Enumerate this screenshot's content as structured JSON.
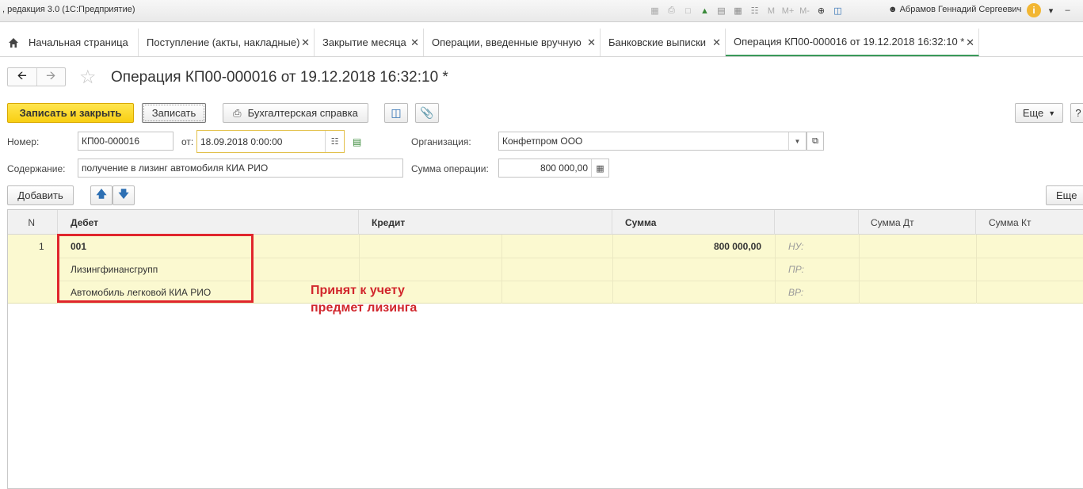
{
  "titlebar": {
    "app_title": ", редакция 3.0  (1С:Предприятие)",
    "user_name": "Абрамов Геннадий Сергеевич",
    "zoom_labels": [
      "M",
      "M+",
      "M-"
    ]
  },
  "tabs": [
    {
      "label": "Начальная страница",
      "closable": false,
      "icon": "home-icon"
    },
    {
      "label": "Поступление (акты, накладные)",
      "closable": true
    },
    {
      "label": "Закрытие месяца",
      "closable": true
    },
    {
      "label": "Операции, введенные вручную",
      "closable": true
    },
    {
      "label": "Банковские выписки",
      "closable": true
    },
    {
      "label": "Операция КП00-000016 от 19.12.2018 16:32:10 *",
      "closable": true,
      "active": true
    }
  ],
  "close_glyph": "✕",
  "doc": {
    "title": "Операция КП00-000016 от 19.12.2018 16:32:10 *"
  },
  "toolbar": {
    "save_close": "Записать и закрыть",
    "save": "Записать",
    "accounting_report": "Бухгалтерская справка",
    "more": "Еще",
    "help": "?"
  },
  "form": {
    "number_label": "Номер:",
    "number_value": "КП00-000016",
    "date_label": "от:",
    "date_value": "18.09.2018  0:00:00",
    "org_label": "Организация:",
    "org_value": "Конфетпром ООО",
    "content_label": "Содержание:",
    "content_value": "получение в лизинг автомобиля КИА РИО",
    "sum_label": "Сумма операции:",
    "sum_value": "800 000,00"
  },
  "table_toolbar": {
    "add": "Добавить",
    "more": "Еще"
  },
  "table": {
    "columns": [
      "N",
      "Дебет",
      "Кредит",
      "Сумма",
      "",
      "Сумма Дт",
      "Сумма Кт"
    ],
    "rows": [
      {
        "n": "1",
        "debit_lines": [
          "001",
          "Лизингфинансгрупп",
          "Автомобиль легковой КИА РИО"
        ],
        "credit_lines": [
          "",
          "",
          ""
        ],
        "sum": "800 000,00",
        "tax_labels": [
          "НУ:",
          "ПР:",
          "ВР:"
        ]
      }
    ]
  },
  "annotation": {
    "line1": "Принят к учету",
    "line2": "предмет лизинга",
    "color": "#d1262c"
  },
  "colors": {
    "primary_button": "#f8cf12",
    "row_highlight": "#fbf9d0",
    "active_tab_accent": "#3a9a5a",
    "annotation_box": "#e0262c"
  }
}
